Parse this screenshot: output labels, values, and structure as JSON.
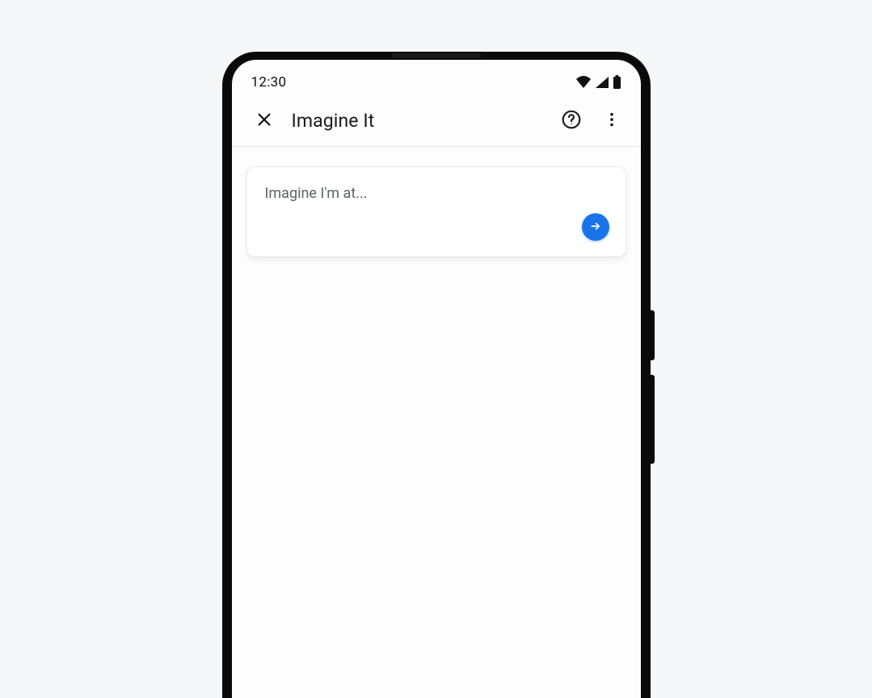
{
  "status": {
    "time": "12:30"
  },
  "appbar": {
    "title": "Imagine It"
  },
  "prompt": {
    "placeholder": "Imagine I'm at...",
    "value": ""
  },
  "colors": {
    "accent": "#1a73e8"
  }
}
